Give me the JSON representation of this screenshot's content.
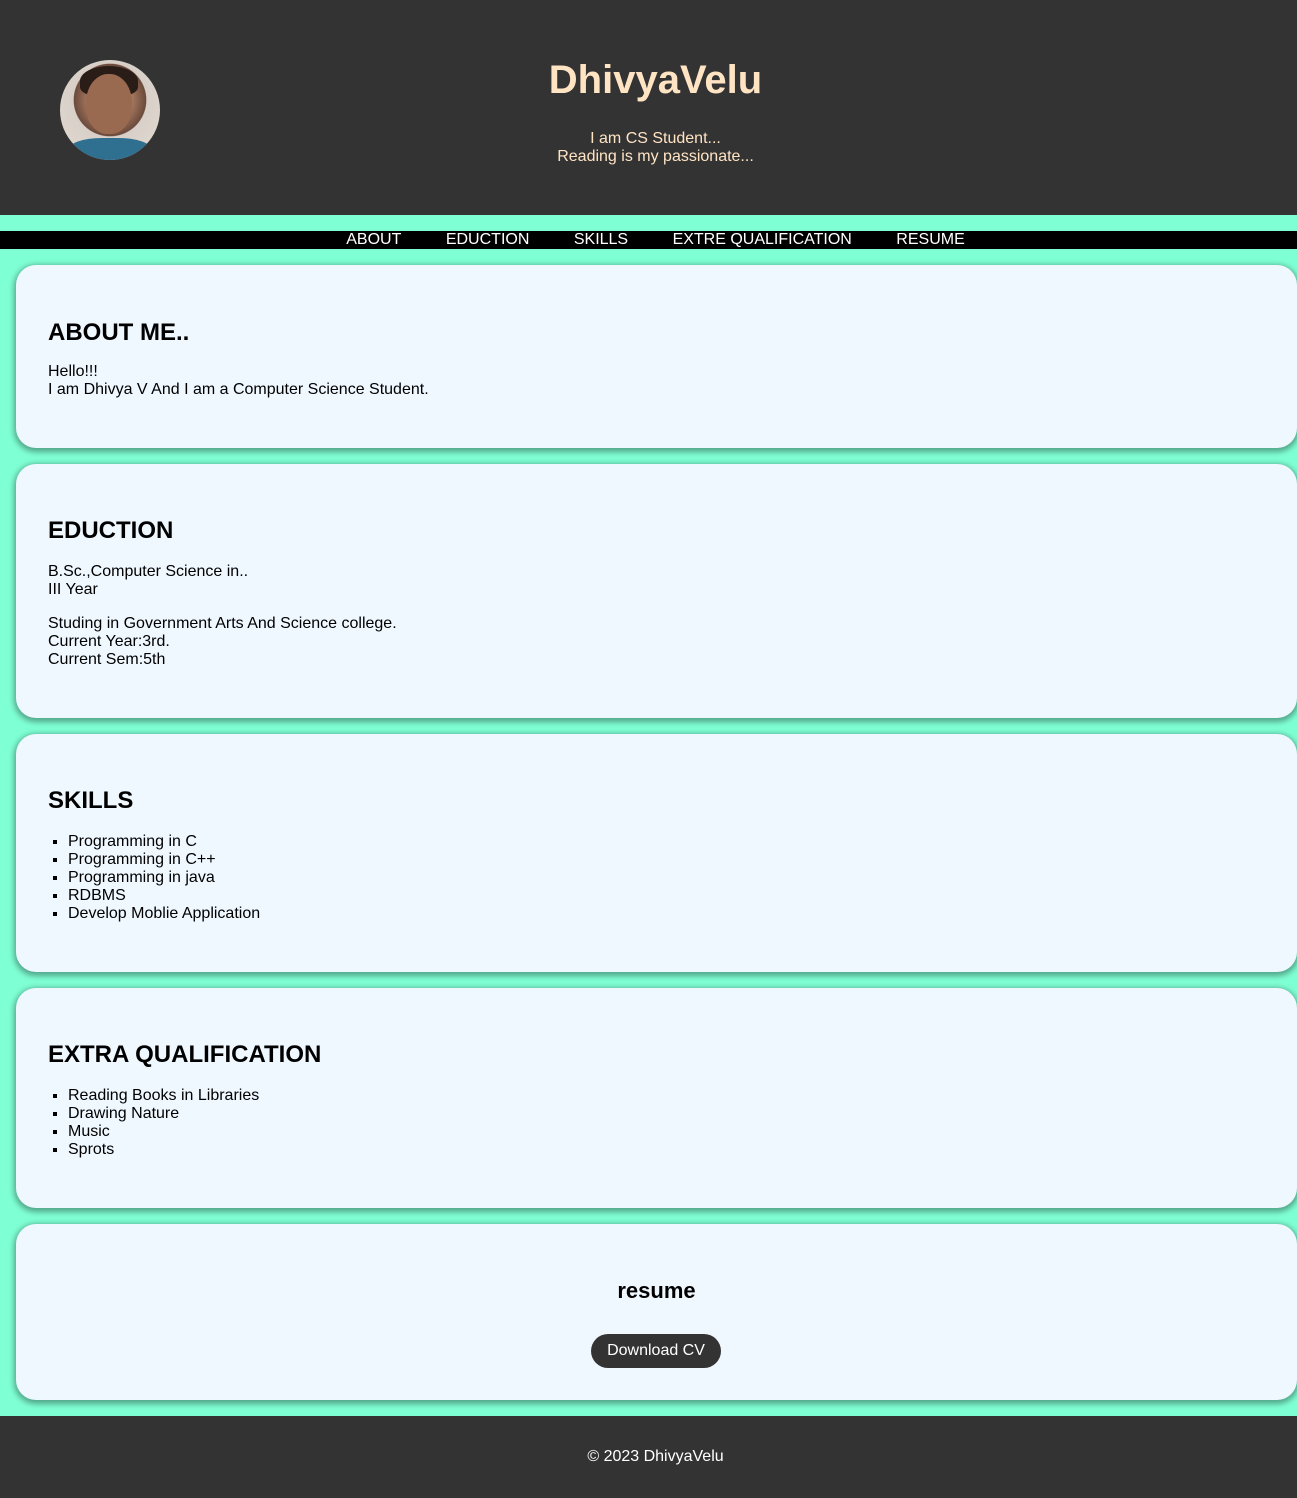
{
  "header": {
    "name": "DhivyaVelu",
    "tagline_line1": "I am CS Student...",
    "tagline_line2": "Reading is my passionate..."
  },
  "nav": {
    "items": [
      {
        "label": "ABOUT"
      },
      {
        "label": "EDUCTION"
      },
      {
        "label": "SKILLS"
      },
      {
        "label": "EXTRE QUALIFICATION"
      },
      {
        "label": "RESUME"
      }
    ]
  },
  "about": {
    "heading": "ABOUT ME..",
    "line1": "Hello!!!",
    "line2": "I am Dhivya V And I am a Computer Science Student.",
    "dot": "."
  },
  "education": {
    "heading": "EDUCTION",
    "degree": "B.Sc.,Computer Science in..",
    "year": "III Year",
    "college": "Studing in Government Arts And Science college.",
    "current_year": "Current Year:3rd.",
    "current_sem": "Current Sem:5th"
  },
  "skills": {
    "heading": "SKILLS",
    "items": [
      "Programming in C",
      "Programming in C++",
      "Programming in java",
      "RDBMS",
      "Develop Moblie Application"
    ]
  },
  "extra": {
    "heading": "EXTRA QUALIFICATION",
    "items": [
      "Reading Books in Libraries",
      "Drawing Nature",
      "Music",
      "Sprots"
    ]
  },
  "resume": {
    "heading": "resume",
    "button_label": "Download CV"
  },
  "footer": {
    "text": "© 2023 DhivyaVelu"
  },
  "colors": {
    "page_background": "#7fffd4",
    "header_background": "#333333",
    "title_color": "#ffe4c4",
    "card_background": "#f0f8ff",
    "nav_background": "#000000"
  }
}
